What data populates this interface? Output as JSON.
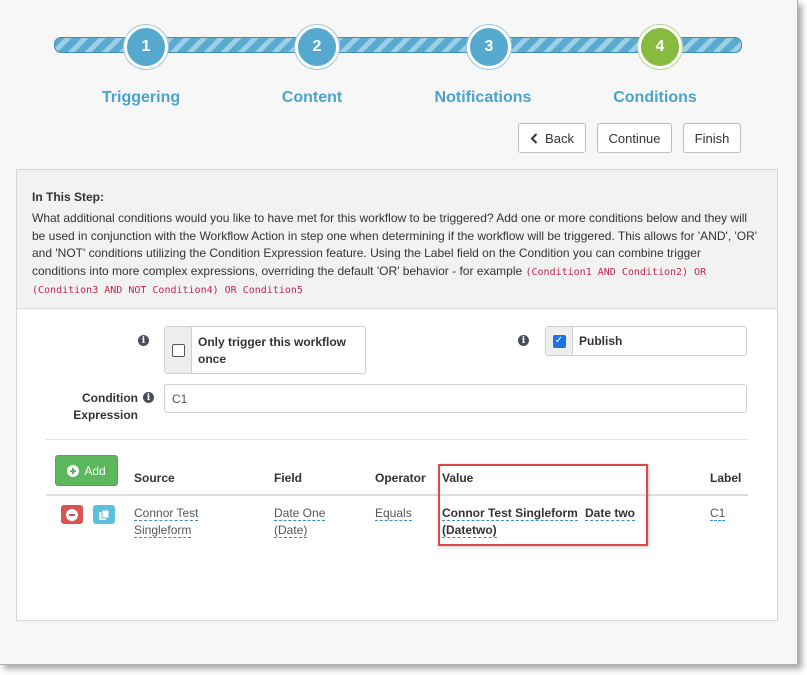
{
  "stepper": {
    "steps": [
      {
        "number": "1",
        "label": "Triggering"
      },
      {
        "number": "2",
        "label": "Content"
      },
      {
        "number": "3",
        "label": "Notifications"
      },
      {
        "number": "4",
        "label": "Conditions"
      }
    ],
    "active_step": 4
  },
  "nav": {
    "back_label": "Back",
    "continue_label": "Continue",
    "finish_label": "Finish"
  },
  "info": {
    "title": "In This Step:",
    "text": "What additional conditions would you like to have met for this workflow to be triggered? Add one or more conditions below and they will be used in conjunction with the Workflow Action in step one when determining if the workflow will be triggered. This allows for 'AND', 'OR' and 'NOT' conditions utilizing the Condition Expression feature. Using the Label field on the Condition you can combine trigger conditions into more complex expressions, overriding the default 'OR' behavior - for example",
    "example": "(Condition1 AND Condition2) OR (Condition3 AND NOT Condition4) OR Condition5"
  },
  "options": {
    "trigger_once_label": "Only trigger this workflow once",
    "trigger_once_checked": false,
    "publish_label": "Publish",
    "publish_checked": true
  },
  "condition_expression": {
    "label": "Condition Expression",
    "value": "C1"
  },
  "table": {
    "add_label": "Add",
    "headers": {
      "source": "Source",
      "field": "Field",
      "operator": "Operator",
      "value": "Value",
      "label": "Label"
    },
    "rows": [
      {
        "source": "Connor Test Singleform",
        "field": "Date One (Date)",
        "operator": "Equals",
        "value_form": "Connor Test Singleform",
        "value_field": "(Datetwo)",
        "value_name": "Date two",
        "label": "C1"
      }
    ]
  },
  "colors": {
    "step_blue": "#55a9cf",
    "step_active_green": "#86bb3f",
    "highlight_red": "#e04848",
    "add_green": "#5cb85c",
    "delete_red": "#d9534f",
    "copy_blue": "#5bc0de"
  }
}
